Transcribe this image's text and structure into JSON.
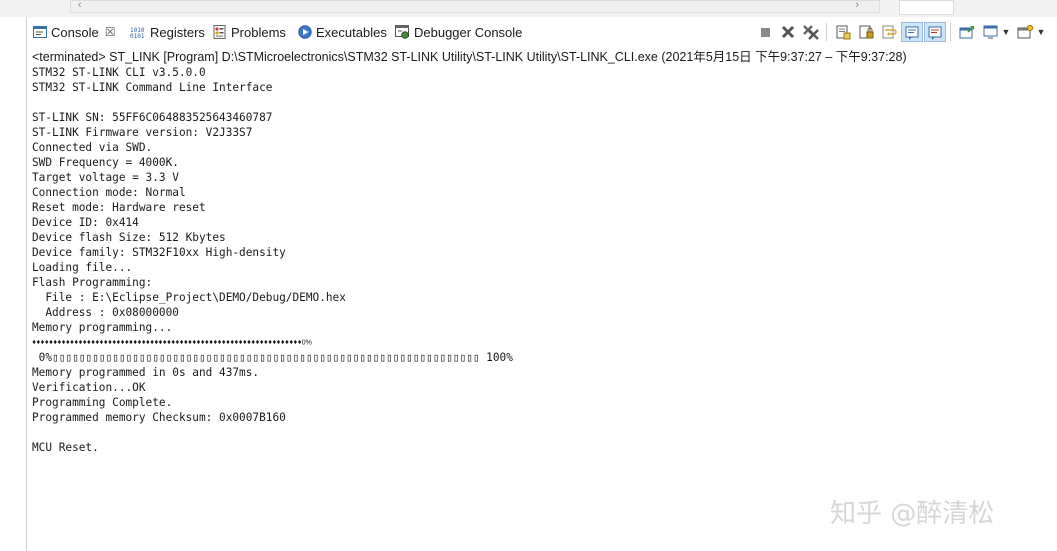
{
  "tabs": [
    {
      "label": "Console",
      "icon": "console-icon"
    },
    {
      "label": "Registers",
      "icon": "registers-icon"
    },
    {
      "label": "Problems",
      "icon": "problems-icon"
    },
    {
      "label": "Executables",
      "icon": "executables-icon"
    },
    {
      "label": "Debugger Console",
      "icon": "debugger-console-icon"
    }
  ],
  "status_line": "<terminated> ST_LINK [Program] D:\\STMicroelectronics\\STM32 ST-LINK Utility\\ST-LINK Utility\\ST-LINK_CLI.exe (2021年5月15日 下午9:37:27 – 下午9:37:28)",
  "console": {
    "lines_a": [
      "STM32 ST-LINK CLI v3.5.0.0",
      "STM32 ST-LINK Command Line Interface",
      "",
      "ST-LINK SN: 55FF6C064883525643460787",
      "ST-LINK Firmware version: V2J33S7",
      "Connected via SWD.",
      "SWD Frequency = 4000K.",
      "Target voltage = 3.3 V",
      "Connection mode: Normal",
      "Reset mode: Hardware reset",
      "Device ID: 0x414",
      "Device flash Size: 512 Kbytes",
      "Device family: STM32F10xx High-density",
      "Loading file...",
      "Flash Programming:",
      "  File : E:\\Eclipse_Project\\DEMO/Debug/DEMO.hex",
      "  Address : 0x08000000",
      "Memory programming..."
    ],
    "progress_glyphs": "♦♦♦♦♦♦♦♦♦♦♦♦♦♦♦♦♦♦♦♦♦♦♦♦♦♦♦♦♦♦♦♦♦♦♦♦♦♦♦♦♦♦♦♦♦♦♦♦♦♦♦♦♦♦♦♦♦♦♦♦♦♦♦♦",
    "progress_glyphs_pct": "0%",
    "progress_bar_line": " 0%▯▯▯▯▯▯▯▯▯▯▯▯▯▯▯▯▯▯▯▯▯▯▯▯▯▯▯▯▯▯▯▯▯▯▯▯▯▯▯▯▯▯▯▯▯▯▯▯▯▯▯▯▯▯▯▯▯▯▯▯▯▯▯▯ 100%",
    "lines_b": [
      "Memory programmed in 0s and 437ms.",
      "Verification...OK",
      "Programming Complete.",
      "Programmed memory Checksum: 0x0007B160",
      "",
      "MCU Reset."
    ]
  },
  "watermark": "知乎 @醉清松",
  "colors": {
    "accent_pressed": "#cfe3f7",
    "terminate_gray": "#7a7a7a",
    "remove_x": "#5a5a5a"
  }
}
